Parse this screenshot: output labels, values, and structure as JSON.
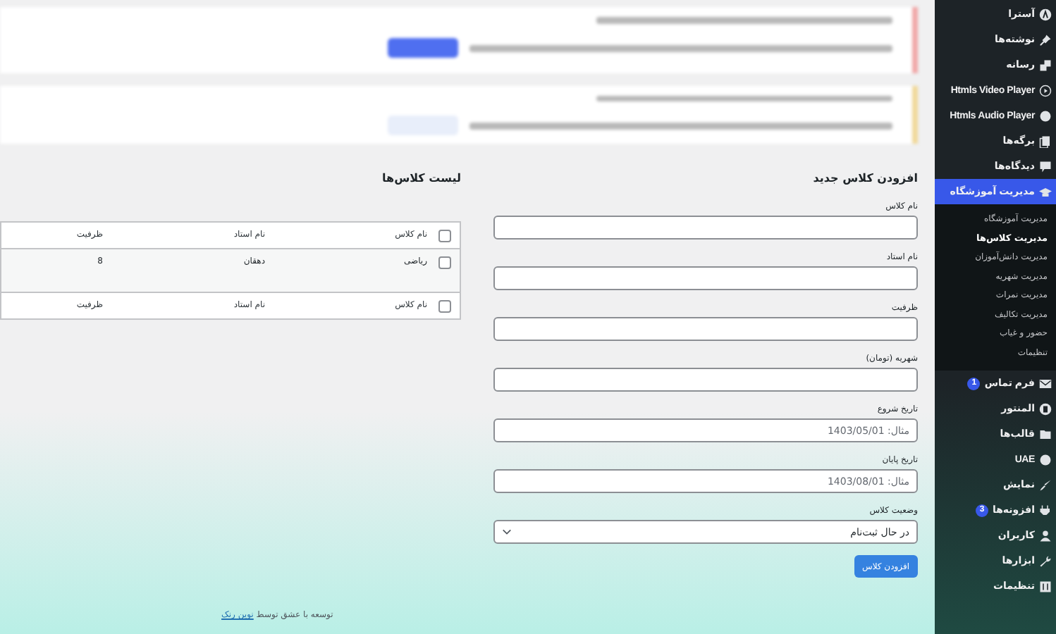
{
  "notices": [
    {
      "kind": "error"
    },
    {
      "kind": "warning"
    }
  ],
  "sidebar": {
    "items": [
      {
        "label": "آسترا",
        "selected": false
      },
      {
        "label": "نوشته‌ها",
        "selected": false
      },
      {
        "label": "رسانه",
        "selected": false
      },
      {
        "label": "Htmls Video Player",
        "selected": false
      },
      {
        "label": "Htmls Audio Player",
        "selected": false
      },
      {
        "label": "برگه‌ها",
        "selected": false
      },
      {
        "label": "دیدگاه‌ها",
        "selected": false
      },
      {
        "label": "مدیریت آموزشگاه",
        "selected": true,
        "children": [
          {
            "label": "مدیریت آموزشگاه",
            "selected": false
          },
          {
            "label": "مدیریت کلاس‌ها",
            "selected": true
          },
          {
            "label": "مدیریت دانش‌آموزان",
            "selected": false
          },
          {
            "label": "مدیریت شهریه",
            "selected": false
          },
          {
            "label": "مدیریت نمرات",
            "selected": false
          },
          {
            "label": "مدیریت تکالیف",
            "selected": false
          },
          {
            "label": "حضور و غیاب",
            "selected": false
          },
          {
            "label": "تنظیمات",
            "selected": false
          }
        ]
      },
      {
        "label": "فرم تماس",
        "selected": false,
        "badge": "1"
      },
      {
        "label": "المنتور",
        "selected": false
      },
      {
        "label": "قالب‌ها",
        "selected": false
      },
      {
        "label": "UAE",
        "selected": false
      },
      {
        "label": "نمایش",
        "selected": false
      },
      {
        "label": "افزونه‌ها",
        "selected": false,
        "badge": "3"
      },
      {
        "label": "کاربران",
        "selected": false
      },
      {
        "label": "ابزارها",
        "selected": false
      },
      {
        "label": "تنظیمات",
        "selected": false
      }
    ]
  },
  "form": {
    "title": "افزودن کلاس جدید",
    "fields": [
      {
        "kind": "text",
        "label": "نام کلاس"
      },
      {
        "kind": "text",
        "label": "نام استاد"
      },
      {
        "kind": "text",
        "label": "ظرفیت"
      },
      {
        "kind": "text",
        "label": "شهریه (تومان)"
      },
      {
        "kind": "text",
        "label": "تاریخ شروع",
        "placeholder": "مثال: 1403/05/01"
      },
      {
        "kind": "text",
        "label": "تاریخ پایان",
        "placeholder": "مثال: 1403/08/01"
      },
      {
        "kind": "select",
        "label": "وضعیت کلاس",
        "value": "در حال ثبت‌نام"
      }
    ],
    "button": "افزودن کلاس"
  },
  "list": {
    "title": "لیست کلاس‌ها",
    "columns": [
      "نام کلاس",
      "نام استاد",
      "ظرفیت"
    ],
    "footer_columns": [
      "نام کلاس",
      "نام استاد",
      "ظرفیت"
    ],
    "header_checked": false,
    "footer_checked": false,
    "rows": [
      {
        "checked": false,
        "cells": [
          "ریاضی",
          "دهقان",
          "8"
        ]
      }
    ]
  },
  "footer": {
    "text": "توسعه با عشق توسط",
    "link": "نوین رنک"
  }
}
